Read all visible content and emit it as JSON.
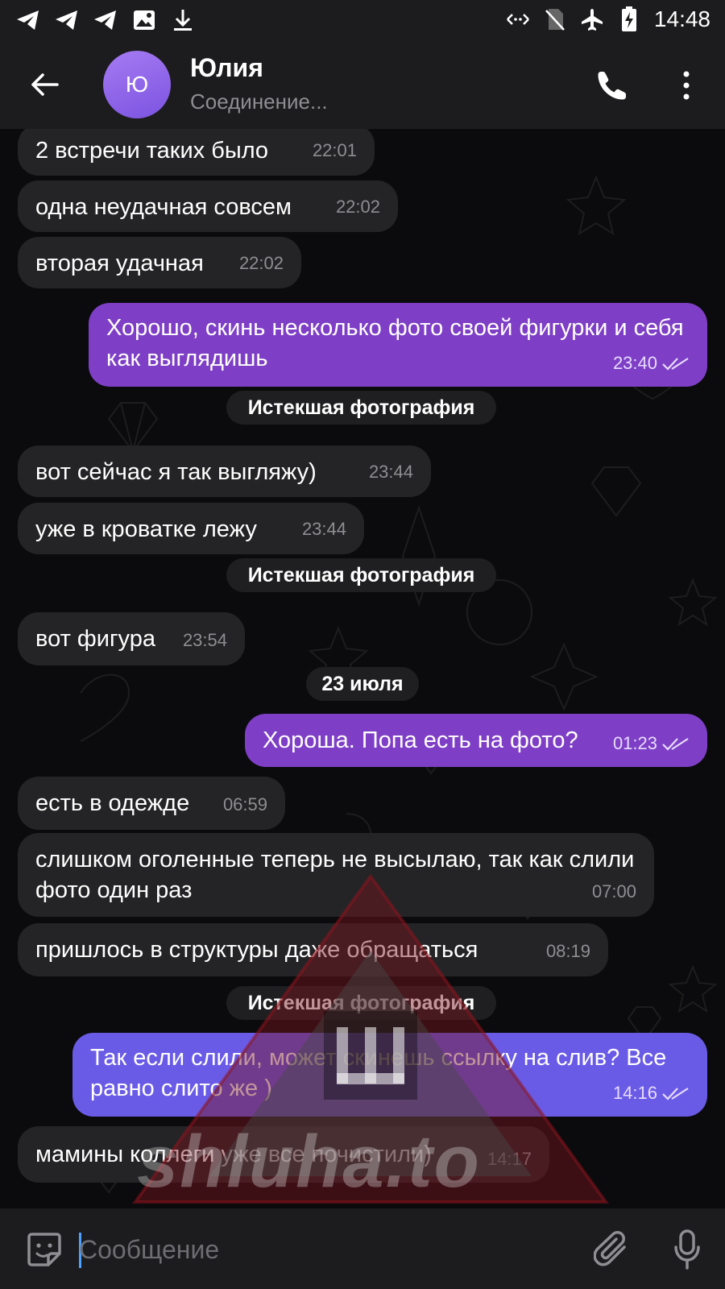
{
  "status_bar": {
    "time": "14:48"
  },
  "header": {
    "avatar_letter": "Ю",
    "contact_name": "Юлия",
    "contact_status": "Соединение..."
  },
  "messages": [
    {
      "dir": "in",
      "text": "2 встречи таких было",
      "time": "22:01"
    },
    {
      "dir": "in",
      "text": "одна неудачная совсем",
      "time": "22:02"
    },
    {
      "dir": "in",
      "text": "вторая удачная",
      "time": "22:02"
    },
    {
      "dir": "out",
      "text": "Хорошо, скинь несколько фото своей фигурки и себя как выглядишь",
      "time": "23:40"
    },
    {
      "dir": "in",
      "text": "вот сейчас я так выгляжу)",
      "time": "23:44"
    },
    {
      "dir": "in",
      "text": "уже в кроватке лежу",
      "time": "23:44"
    },
    {
      "dir": "in",
      "text": "вот фигура",
      "time": "23:54"
    },
    {
      "dir": "out",
      "text": "Хороша. Попа есть на фото?",
      "time": "01:23"
    },
    {
      "dir": "in",
      "text": "есть в одежде",
      "time": "06:59"
    },
    {
      "dir": "in",
      "text": "слишком оголенные теперь не высылаю, так как слили фото один раз",
      "time": "07:00"
    },
    {
      "dir": "in",
      "text": "пришлось в структуры даже обращаться",
      "time": "08:19"
    },
    {
      "dir": "out",
      "text": "Так если слили, может скинешь ссылку на слив? Все равно слито же )",
      "time": "14:16"
    },
    {
      "dir": "in",
      "text": "мамины коллеги уже все почистили)",
      "time": "14:17"
    }
  ],
  "service": {
    "expired_photo_1": "Истекшая фотография",
    "expired_photo_2": "Истекшая фотография",
    "date_divider": "23 июля",
    "expired_photo_3": "Истекшая фотография"
  },
  "watermark": {
    "text": "shluha.to"
  },
  "input": {
    "placeholder": "Сообщение"
  },
  "colors": {
    "outgoing_bubble": "#7e3fc6",
    "outgoing_bubble_alt": "#6a5be6",
    "incoming_bubble": "#242426",
    "avatar": "#8b5cf0",
    "caret": "#4ea1ff"
  }
}
